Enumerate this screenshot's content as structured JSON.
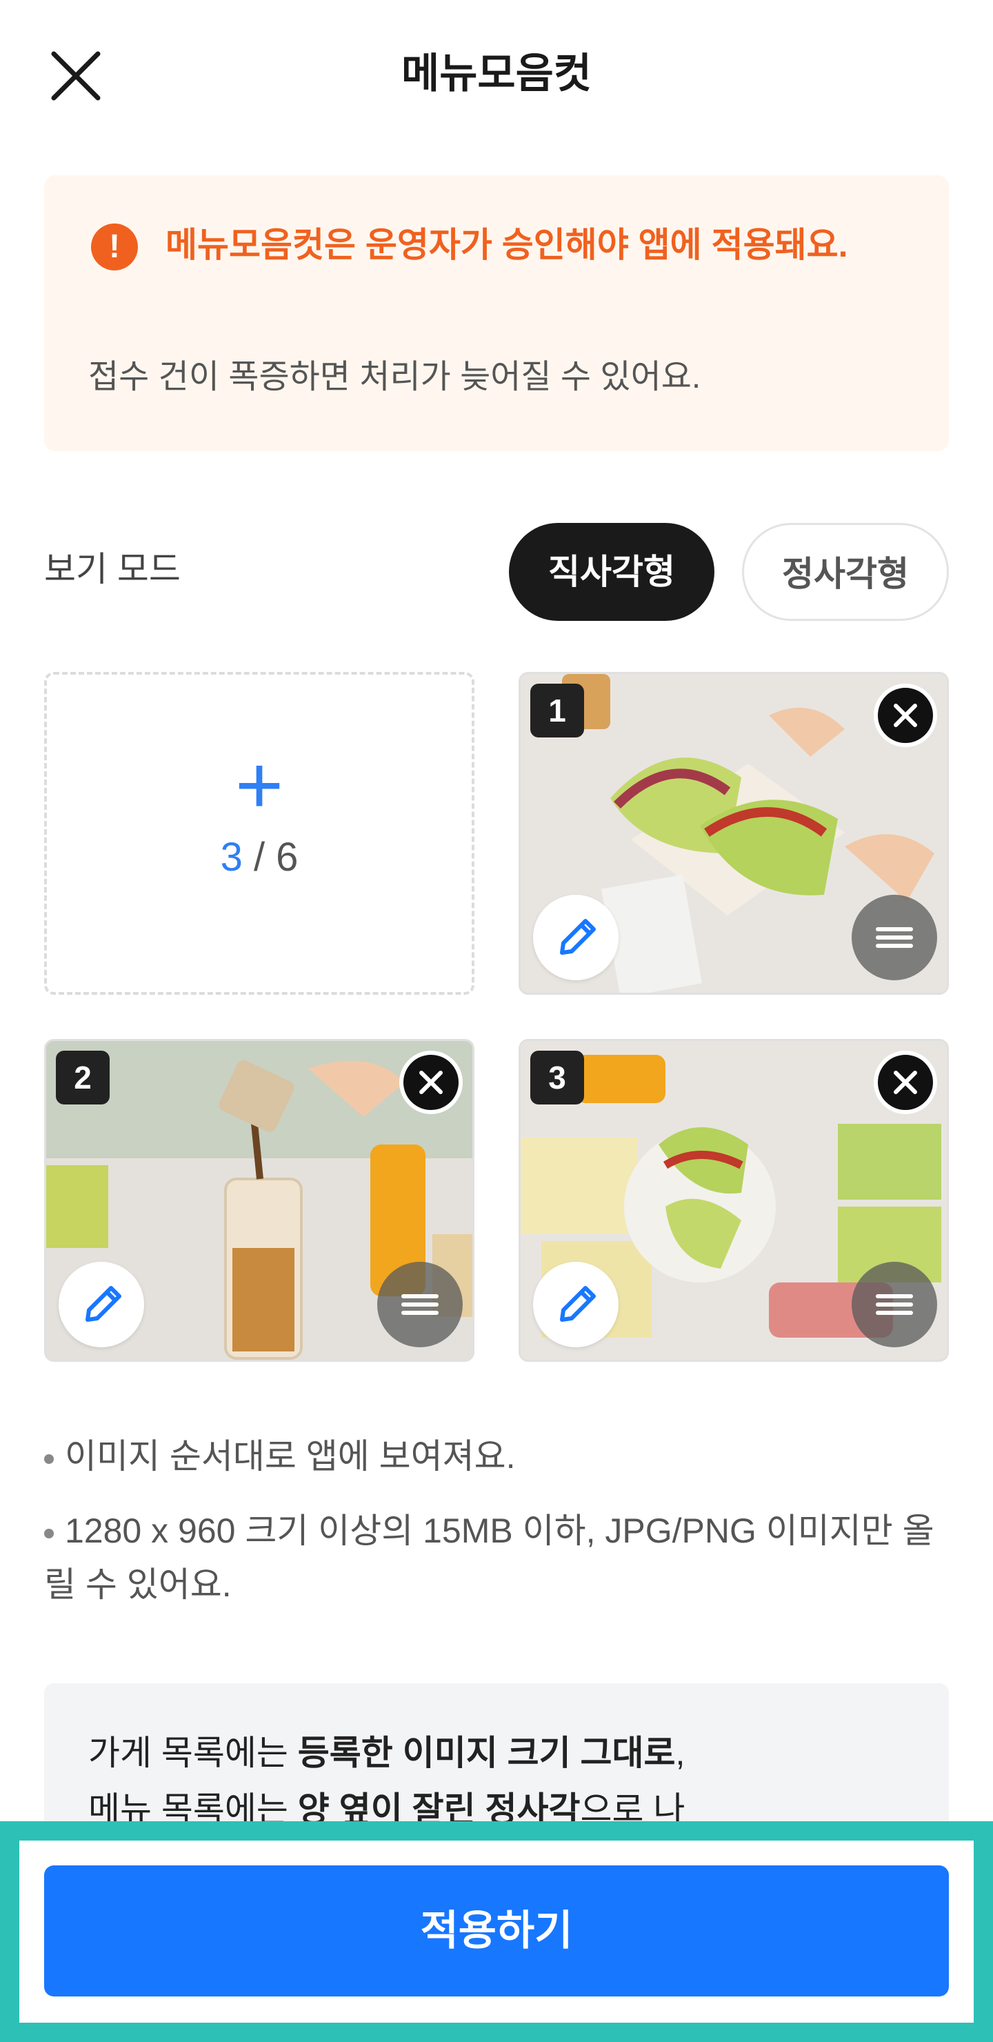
{
  "header": {
    "title": "메뉴모음컷",
    "close_icon": "close-icon"
  },
  "notice": {
    "icon": "exclamation-icon",
    "title": "메뉴모음컷은 운영자가 승인해야 앱에 적용돼요.",
    "desc": "접수 건이 폭증하면 처리가 늦어질 수 있어요.",
    "accent": "#f0611f"
  },
  "view_mode": {
    "label": "보기 모드",
    "options": [
      "직사각형",
      "정사각형"
    ],
    "selected": "직사각형"
  },
  "gallery": {
    "add_tile": {
      "current": "3",
      "separator": " / ",
      "max": "6"
    },
    "photos": [
      {
        "index": "1",
        "subject": "sandwich-held-in-hands"
      },
      {
        "index": "2",
        "subject": "coffee-pour-into-bottle"
      },
      {
        "index": "3",
        "subject": "sandwiches-and-juices-spread"
      }
    ]
  },
  "guidelines": [
    "이미지 순서대로 앱에 보여져요.",
    "1280 x 960 크기 이상의 15MB 이하, JPG/PNG 이미지만 올릴 수 있어요."
  ],
  "info": {
    "line1_prefix": "가게 목록에는 ",
    "line1_bold": "등록한 이미지 크기 그대로",
    "line1_suffix": ",",
    "line2_prefix": "메뉴 목록에는 ",
    "line2_bold": "양 옆이 잘린 정사각",
    "line2_suffix": "으로 나"
  },
  "apply_button": {
    "label": "적용하기",
    "color": "#1877ff"
  }
}
